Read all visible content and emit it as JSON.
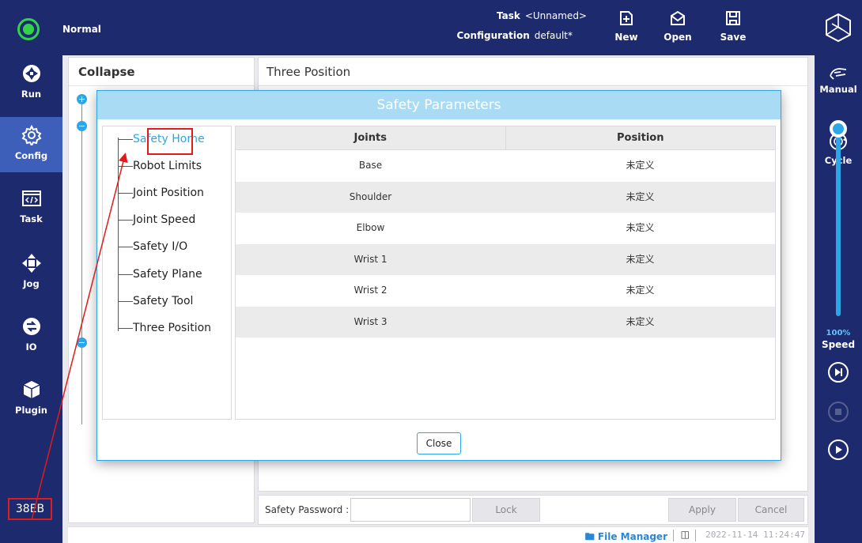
{
  "topbar": {
    "mode": "Normal",
    "task_key": "Task",
    "task_value": "<Unnamed>",
    "config_key": "Configuration",
    "config_value": "default*",
    "buttons": {
      "new": "New",
      "open": "Open",
      "save": "Save"
    }
  },
  "leftnav": {
    "items": [
      "Run",
      "Config",
      "Task",
      "Jog",
      "IO",
      "Plugin"
    ],
    "active": "Config",
    "build_code": "38EB"
  },
  "rightnav": {
    "manual": "Manual",
    "cycle": "Cycle",
    "speed_value": "100%",
    "speed_label": "Speed",
    "speed_fraction": 1.0
  },
  "panels": {
    "left_title": "Collapse",
    "right_title": "Three Position"
  },
  "modal": {
    "title": "Safety Parameters",
    "nav": [
      "Safety Home",
      "Robot Limits",
      "Joint Position",
      "Joint Speed",
      "Safety I/O",
      "Safety Plane",
      "Safety Tool",
      "Three Position"
    ],
    "active_nav": "Safety Home",
    "table": {
      "headers": [
        "Joints",
        "Position"
      ],
      "rows": [
        [
          "Base",
          "未定义"
        ],
        [
          "Shoulder",
          "未定义"
        ],
        [
          "Elbow",
          "未定义"
        ],
        [
          "Wrist 1",
          "未定义"
        ],
        [
          "Wrist 2",
          "未定义"
        ],
        [
          "Wrist 3",
          "未定义"
        ]
      ]
    },
    "close_label": "Close"
  },
  "password_bar": {
    "label": "Safety Password :",
    "value": "",
    "lock": "Lock",
    "apply": "Apply",
    "cancel": "Cancel"
  },
  "footer": {
    "file_manager": "File Manager",
    "timestamp": "2022-11-14 11:24:47"
  },
  "colors": {
    "nav_bg": "#1e2a6e",
    "active_nav": "#3d5fba",
    "accent": "#2da6e8",
    "status_ok": "#32d24b",
    "highlight": "#e01b1b"
  }
}
